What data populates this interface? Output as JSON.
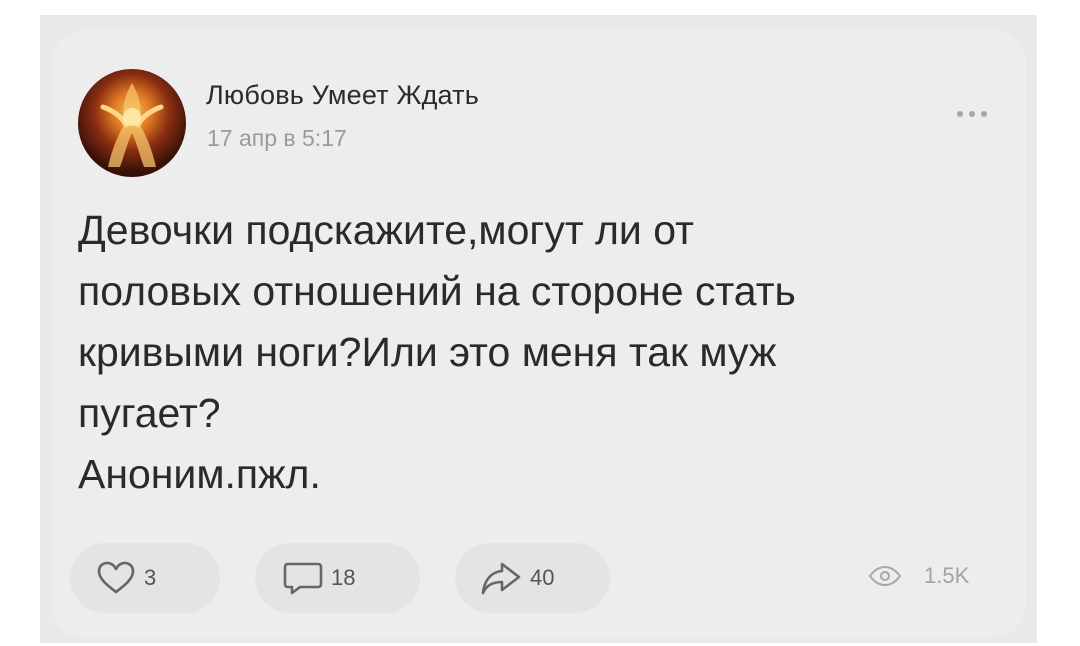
{
  "post": {
    "author": "Любовь Умеет Ждать",
    "date": "17 апр в 5:17",
    "text": "Девочки подскажите,могут ли от\nполовых отношений на стороне стать\nкривыми ноги?Или это меня так муж\nпугает?\nАноним.пжл.",
    "avatar_icon": "group-avatar-image",
    "more_icon": "more-dots-icon"
  },
  "actions": {
    "likes": "3",
    "comments": "18",
    "shares": "40",
    "views": "1.5K"
  },
  "colors": {
    "card_background": "#ededed",
    "text": "#2a2a2a",
    "secondary_text": "#9a9a9a",
    "button_background": "#e4e4e4"
  }
}
